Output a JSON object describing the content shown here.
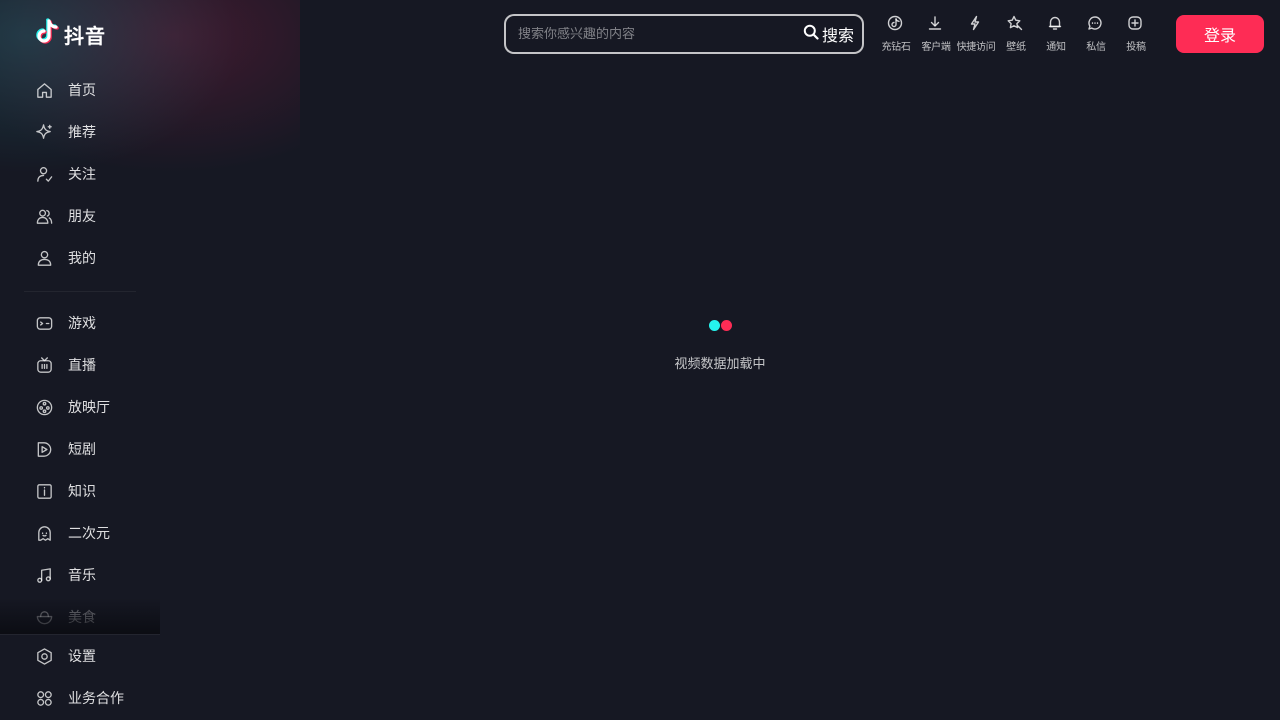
{
  "app": {
    "name": "抖音"
  },
  "sidebar": {
    "primary": [
      {
        "label": "首页",
        "icon": "home-icon"
      },
      {
        "label": "推荐",
        "icon": "sparkle-icon"
      },
      {
        "label": "关注",
        "icon": "follow-icon"
      },
      {
        "label": "朋友",
        "icon": "friends-icon"
      },
      {
        "label": "我的",
        "icon": "user-icon"
      }
    ],
    "secondary": [
      {
        "label": "游戏",
        "icon": "gamepad-icon"
      },
      {
        "label": "直播",
        "icon": "tv-icon"
      },
      {
        "label": "放映厅",
        "icon": "film-reel-icon"
      },
      {
        "label": "短剧",
        "icon": "play-icon"
      },
      {
        "label": "知识",
        "icon": "info-icon"
      },
      {
        "label": "二次元",
        "icon": "ghost-icon"
      },
      {
        "label": "音乐",
        "icon": "music-note-icon"
      },
      {
        "label": "美食",
        "icon": "bowl-icon"
      }
    ],
    "bottom": [
      {
        "label": "设置",
        "icon": "settings-icon"
      },
      {
        "label": "业务合作",
        "icon": "grid-icon"
      }
    ]
  },
  "header": {
    "search": {
      "placeholder": "搜索你感兴趣的内容",
      "value": "",
      "button_label": "搜索"
    },
    "tools": [
      {
        "label": "充钻石",
        "icon": "diamond-icon"
      },
      {
        "label": "客户端",
        "icon": "download-icon"
      },
      {
        "label": "快捷访问",
        "icon": "lightning-icon"
      },
      {
        "label": "壁纸",
        "icon": "wallpaper-icon"
      },
      {
        "label": "通知",
        "icon": "bell-icon"
      },
      {
        "label": "私信",
        "icon": "message-icon"
      },
      {
        "label": "投稿",
        "icon": "upload-icon"
      }
    ],
    "login_label": "登录"
  },
  "main": {
    "loading_text": "视频数据加载中"
  },
  "colors": {
    "background": "#161823",
    "accent": "#fe2c55",
    "cyan": "#25f4ee"
  }
}
